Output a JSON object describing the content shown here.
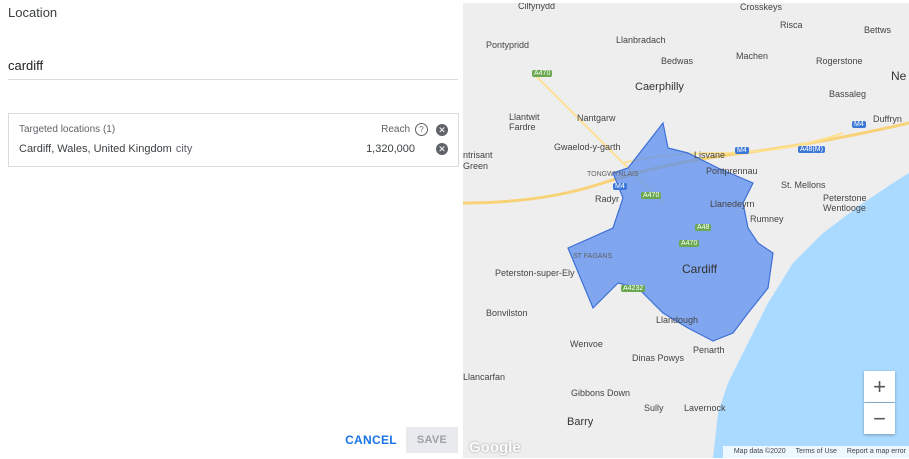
{
  "location": {
    "label": "Location",
    "search_value": "cardiff"
  },
  "targeted": {
    "header": "Targeted locations (1)",
    "reach_label": "Reach",
    "items": [
      {
        "name": "Cardiff, Wales, United Kingdom",
        "type": "city",
        "reach": "1,320,000"
      }
    ]
  },
  "actions": {
    "cancel": "CANCEL",
    "save": "SAVE"
  },
  "map": {
    "places": [
      "Cilfynydd",
      "Crosskeys",
      "Risca",
      "Bettws",
      "Pontypridd",
      "Llanbradach",
      "Machen",
      "Rogerstone",
      "Ne",
      "Bedwas",
      "Caerphilly",
      "Bassaleg",
      "Llantwit Fardre",
      "Nantgarw",
      "Duffryn",
      "Gwaelod-y-garth",
      "Lisvane",
      "Pontprennau",
      "St. Mellons",
      "Peterstone Wentlooge",
      "Llanedeyrn",
      "Rumney",
      "Radyr",
      "TONGWYNLAIS",
      "Cardiff",
      "ST FAGANS",
      "Peterston-super-Ely",
      "Bonvilston",
      "Llandough",
      "Penarth",
      "Wenvoe",
      "Dinas Powys",
      "Llancarfan",
      "Gibbons Down",
      "Sully",
      "Lavernock",
      "Barry",
      "ntrisant Green"
    ],
    "roads": [
      "A470",
      "M4",
      "A48(M)",
      "A470",
      "A48",
      "A470",
      "A4232",
      "M4",
      "M4"
    ],
    "zoom_in": "+",
    "zoom_out": "−",
    "logo": "Google",
    "footer": [
      "Map data ©2020",
      "Terms of Use",
      "Report a map error"
    ],
    "colors": {
      "water": "#aadaff",
      "polygon_fill": "#5b8def",
      "polygon_stroke": "#3d6fd6"
    }
  }
}
